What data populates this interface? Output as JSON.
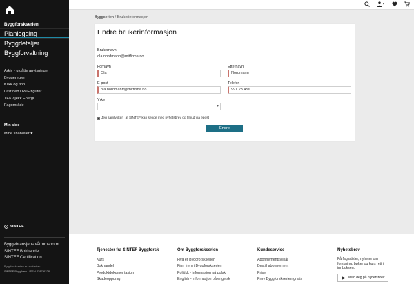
{
  "sidebar": {
    "brand": "Byggforskserien",
    "main_items": [
      "Planlegging",
      "Byggdetaljer",
      "Byggforvaltning"
    ],
    "sub_items": [
      "Arkiv - utgåtte anvisninger",
      "Byggeregler",
      "Klikk og finn",
      "Last ned DWG-figurer",
      "TEK-sjekk Energi",
      "Fagområde"
    ],
    "min_side_heading": "Min side",
    "min_side_item": "Mine snarveier ♥",
    "sintef": "SINTEF",
    "links": [
      "Byggebransjens våtromsnorm",
      "SINTEF Bokhandel",
      "SINTEF Certification"
    ],
    "fine1": "Byggforskserien er utviklet av",
    "fine2": "SINTEF Byggforsk | ISSN 2387-6328"
  },
  "topbar": {
    "icons": [
      "search-icon",
      "user-icon",
      "heart-icon",
      "cart-icon"
    ]
  },
  "breadcrumb": {
    "home": "Byggserien",
    "separator": "/",
    "current": "Brukerinformasjon"
  },
  "form": {
    "title": "Endre brukerinformasjon",
    "username_label": "Brukernavn",
    "username_value": "ola.nordmann@mitfirma.no",
    "first_name_label": "Fornavn",
    "first_name_value": "Ola",
    "last_name_label": "Etternavn",
    "last_name_value": "Nordmann",
    "email_label": "E-post",
    "email_value": "ola.nordmann@mitfirma.no",
    "phone_label": "Telefon",
    "phone_value": "991 23 456",
    "occupation_label": "Yrke",
    "occupation_value": "",
    "consent_text": "Jeg samtykker i at SINTEF kan sende meg nyhetsbrev og tilbud via epost",
    "consent_checked": true,
    "submit_label": "Endre"
  },
  "footer": {
    "col1": {
      "heading": "Tjenester fra SINTEF Byggforsk",
      "links": [
        "Kurs",
        "Bokhandel",
        "Produktdokumentasjon",
        "Skadeoppdrag"
      ]
    },
    "col2": {
      "heading": "Om Byggforskserien",
      "links": [
        "Hva er Byggforskserien",
        "Finn frem i Byggforskserien",
        "Politikk - informasjon på polsk",
        "English - informasjon på engelsk"
      ]
    },
    "col3": {
      "heading": "Kundeservice",
      "links": [
        "Abonnementsvilkår",
        "Bestill abonnement",
        "Priser",
        "Prøv Byggforskserien gratis"
      ]
    },
    "col4": {
      "heading": "Nyhetsbrev",
      "text": "Få fagartikler, nyheter om forskning, bøker og kurs rett i innboksen.",
      "button": "Meld deg på nyhetsbrev"
    }
  },
  "colors": {
    "sidebar_bg": "#141414",
    "accent": "#1d6f86",
    "required_marker": "#c9746d"
  }
}
